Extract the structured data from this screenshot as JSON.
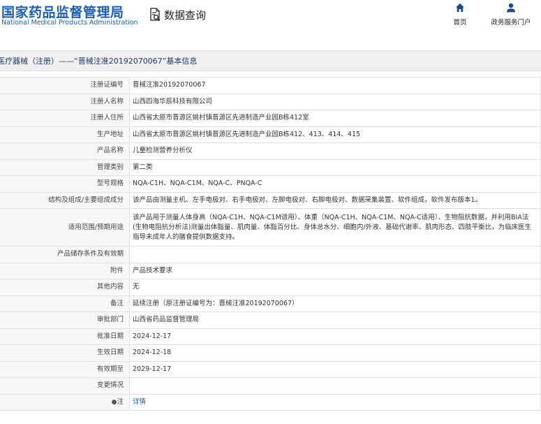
{
  "header": {
    "logo_cn": "国家药品监督管理局",
    "logo_en": "National Medical Products Administration",
    "query_label": "数据查询",
    "nav": [
      {
        "label": "首页",
        "icon": "home-icon"
      },
      {
        "label": "政务服务门户",
        "icon": "user-icon"
      }
    ]
  },
  "title": "医疗器械（注册）——“晋械注准20192070067”基本信息",
  "rows": [
    {
      "label": "注册证编号",
      "value": "晋械注准20192070067"
    },
    {
      "label": "注册人名称",
      "value": "山西四海华辰科技有限公司"
    },
    {
      "label": "注册人住所",
      "value": "山西省太原市晋源区姚村镇晋源区先进制造产业园B栋412室"
    },
    {
      "label": "生产地址",
      "value": "山西省太原市晋源区姚村镇晋源区先进制造产业园B栋412、413、414、415"
    },
    {
      "label": "产品名称",
      "value": "儿童检测营养分析仪"
    },
    {
      "label": "管理类别",
      "value": "第二类"
    },
    {
      "label": "型号规格",
      "value": "NQA-C1H、NQA-C1M、NQA-C、PNQA-C"
    },
    {
      "label": "结构及组成/主要组成成分",
      "value": "该产品由测量主机、左手电极对、右手电极对、左脚电极对、右脚电极对、数据采集装置、软件组成，软件发布版本1。"
    },
    {
      "label": "适用范围/预期用途",
      "value": "该产品用于测量人体身高（NQA-C1H、NQA-C1M适用）、体重（NQA-C1H、NQA-C1M、NQA-C适用）、生物阻抗数据，并利用BIA法(生物电阻抗分析法)测量出体脂量、肌肉量、体脂百分比、身体总水分、细胞内/外液、基础代谢率、肌肉形态、四肢平衡比，为临床医生指导未成年人的膳食提供数据支持。"
    },
    {
      "label": "产品储存条件及有效期",
      "value": ""
    },
    {
      "label": "附件",
      "value": "产品技术要求"
    },
    {
      "label": "其他内容",
      "value": "无"
    },
    {
      "label": "备注",
      "value": "延续注册（原注册证编号为：晋械注准20192070067）"
    },
    {
      "label": "审批部门",
      "value": "山西省药品监督管理局"
    },
    {
      "label": "批准日期",
      "value": "2024-12-17"
    },
    {
      "label": "生效日期",
      "value": "2024-12-18"
    },
    {
      "label": "有效期至",
      "value": "2029-12-17"
    },
    {
      "label": "变更情况",
      "value": ""
    },
    {
      "label": "注",
      "label_prefix": "●",
      "value": "详情"
    }
  ],
  "colors": {
    "brand": "#1a5fb4",
    "band": "#f0f0f0",
    "label_bg": "#f7f7f7",
    "border": "#e1e1e1"
  }
}
